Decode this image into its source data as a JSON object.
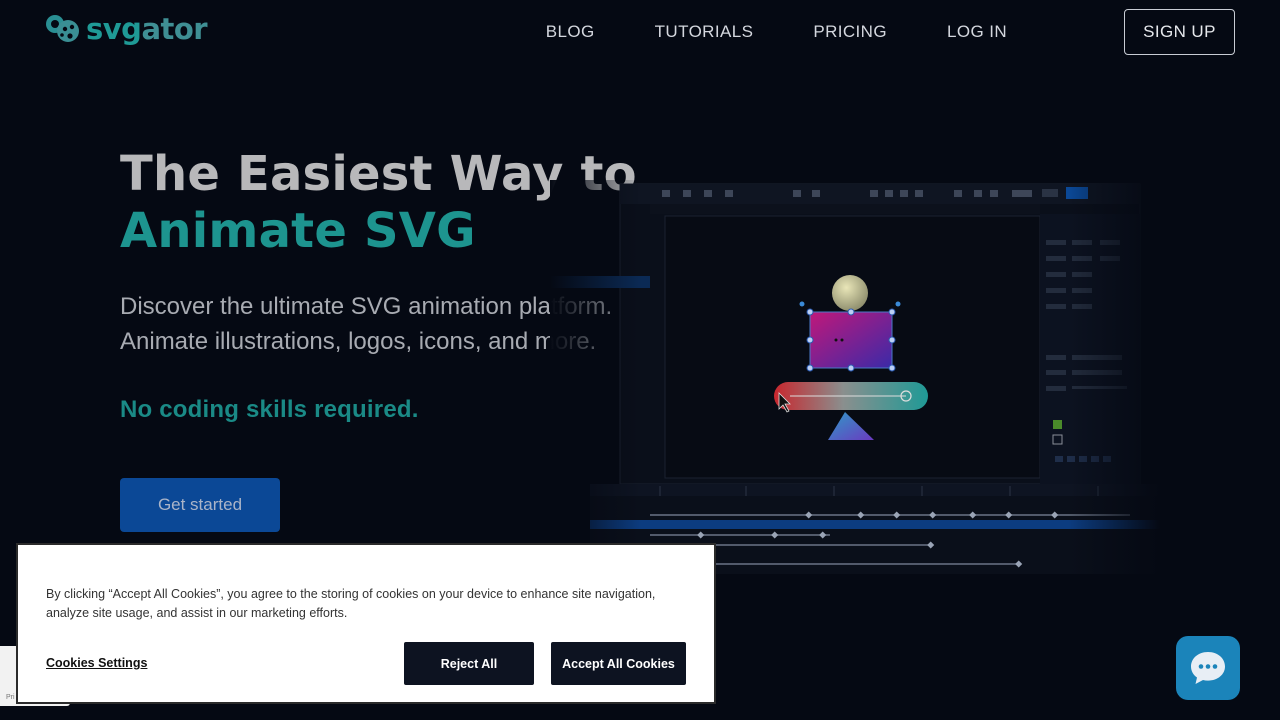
{
  "header": {
    "logo_text_main": "svg",
    "logo_text_rest": "ator",
    "nav": [
      {
        "label": "BLOG"
      },
      {
        "label": "TUTORIALS"
      },
      {
        "label": "PRICING"
      },
      {
        "label": "LOG IN"
      }
    ],
    "signup_label": "SIGN UP"
  },
  "hero": {
    "title_line1": "The Easiest Way to",
    "title_line2": "Animate SVG",
    "description": "Discover the ultimate SVG animation platform. Animate illustrations, logos, icons, and more.",
    "note": "No coding skills required.",
    "cta_label": "Get started"
  },
  "cookie_banner": {
    "text": "By clicking “Accept All Cookies”, you agree to the storing of cookies on your device to enhance site navigation, analyze site usage, and assist in our marketing efforts.",
    "settings_label": "Cookies Settings",
    "reject_label": "Reject All",
    "accept_label": "Accept All Cookies"
  },
  "recaptcha_stub_text": "Pri",
  "colors": {
    "background": "#050913",
    "accent_teal": "#1d948f",
    "cta_blue": "#0b4896",
    "chat_blue": "#1b84ba"
  },
  "icons": {
    "logo": "svgator-gear-logo-icon",
    "chat": "chat-bubble-icon"
  }
}
